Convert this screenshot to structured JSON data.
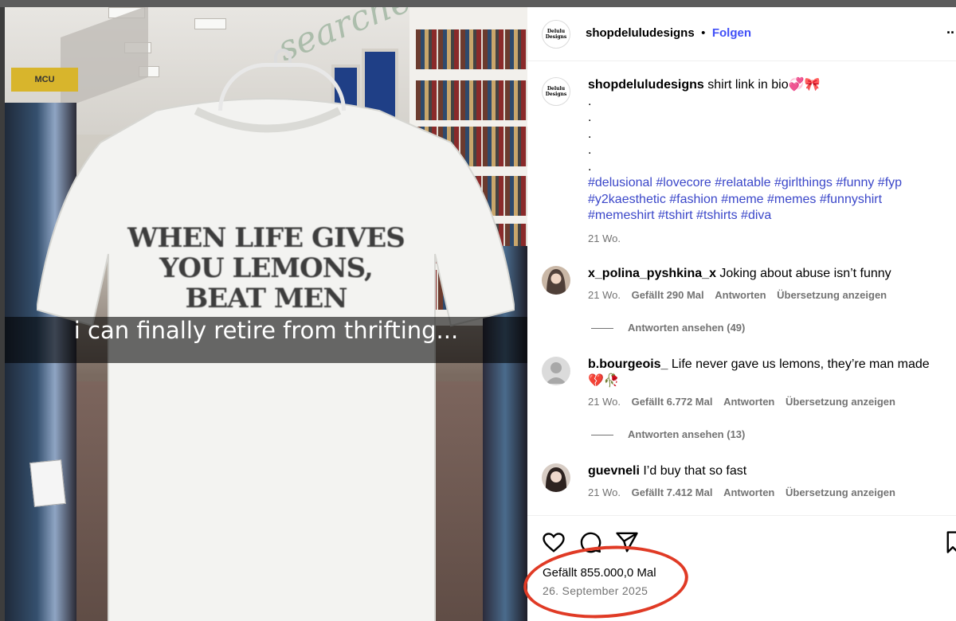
{
  "photo": {
    "store_sign": "MCU",
    "shirt_lines": [
      "WHEN LIFE GIVES",
      "YOU LEMONS,",
      "BEAT MEN"
    ],
    "overlay_caption": "i can finally retire from thrifting..."
  },
  "header": {
    "logo_text": "Delulu Designs",
    "username": "shopdeluludesigns",
    "separator": "•",
    "follow_label": "Folgen",
    "more_label": "··"
  },
  "caption": {
    "username": "shopdeluludesigns",
    "text": "shirt link in bio💞🎀",
    "dots": [
      ".",
      ".",
      ".",
      ".",
      "."
    ],
    "hashtags_line1": "#delusional #lovecore #relatable #girlthings #funny #fyp",
    "hashtags_line2": "#y2kaesthetic #fashion #meme #memes #funnyshirt",
    "hashtags_line3": "#memeshirt #tshirt #tshirts #diva",
    "time": "21 Wo."
  },
  "comments": [
    {
      "username": "x_polina_pyshkina_x",
      "text": "Joking about abuse isn’t funny",
      "time": "21 Wo.",
      "likes": "Gefällt 290 Mal",
      "reply": "Antworten",
      "translate": "Übersetzung anzeigen",
      "view_replies": "Antworten ansehen (49)"
    },
    {
      "username": "b.bourgeois_",
      "text": "Life never gave us lemons, they’re man made",
      "text2": "💔🥀",
      "time": "21 Wo.",
      "likes": "Gefällt 6.772 Mal",
      "reply": "Antworten",
      "translate": "Übersetzung anzeigen",
      "view_replies": "Antworten ansehen (13)"
    },
    {
      "username": "guevneli",
      "text": "I’d buy that so fast",
      "time": "21 Wo.",
      "likes": "Gefällt 7.412 Mal",
      "reply": "Antworten",
      "translate": "Übersetzung anzeigen"
    }
  ],
  "footer": {
    "likes": "Gefällt 855.000,0 Mal",
    "date": "26. September 2025"
  },
  "colors": {
    "link_blue": "#4150f7",
    "hashtag_blue": "#3b47c9",
    "meta_gray": "#737373",
    "annotation_red": "#e03a25"
  }
}
